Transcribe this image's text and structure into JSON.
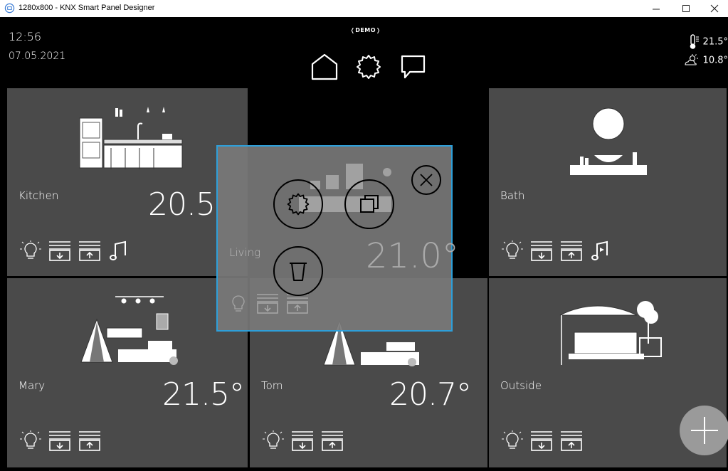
{
  "window": {
    "title": "1280x800 - KNX Smart Panel Designer",
    "controls": [
      "minimize",
      "maximize",
      "close"
    ]
  },
  "header": {
    "time": "12:56",
    "date": "07.05.2021",
    "badge": "DEMO",
    "nav": [
      "home-icon",
      "gear-icon",
      "message-icon"
    ],
    "weather": [
      {
        "icon": "thermometer-icon",
        "value": "21.5°"
      },
      {
        "icon": "sun-cloud-icon",
        "value": "10.8°"
      }
    ]
  },
  "rooms": [
    {
      "name": "Kitchen",
      "temp": "20.5",
      "controls": [
        "light-icon",
        "blind-down-icon",
        "blind-up-icon",
        "music-icon"
      ]
    },
    {
      "name": "Living",
      "temp": "21.0°",
      "controls": [
        "light-icon",
        "blind-down-icon",
        "blind-up-icon"
      ]
    },
    {
      "name": "Bath",
      "temp": "",
      "controls": [
        "light-icon",
        "blind-down-icon",
        "blind-up-icon",
        "music-icon"
      ]
    },
    {
      "name": "Mary",
      "temp": "21.5°",
      "controls": [
        "light-icon",
        "blind-down-icon",
        "blind-up-icon"
      ]
    },
    {
      "name": "Tom",
      "temp": "20.7°",
      "controls": [
        "light-icon",
        "blind-down-icon",
        "blind-up-icon"
      ]
    },
    {
      "name": "Outside",
      "temp": "",
      "controls": [
        "light-icon",
        "blind-down-icon",
        "blind-up-icon"
      ]
    }
  ],
  "edit_popup": {
    "actions": [
      "gear-icon",
      "duplicate-icon",
      "trash-icon"
    ],
    "close": "close-icon",
    "accent": "#2e9fd9"
  },
  "fab": {
    "icon": "plus-icon"
  },
  "colors": {
    "tile": "#4a4a4a",
    "background": "#000000",
    "popup_border": "#2e9fd9"
  }
}
